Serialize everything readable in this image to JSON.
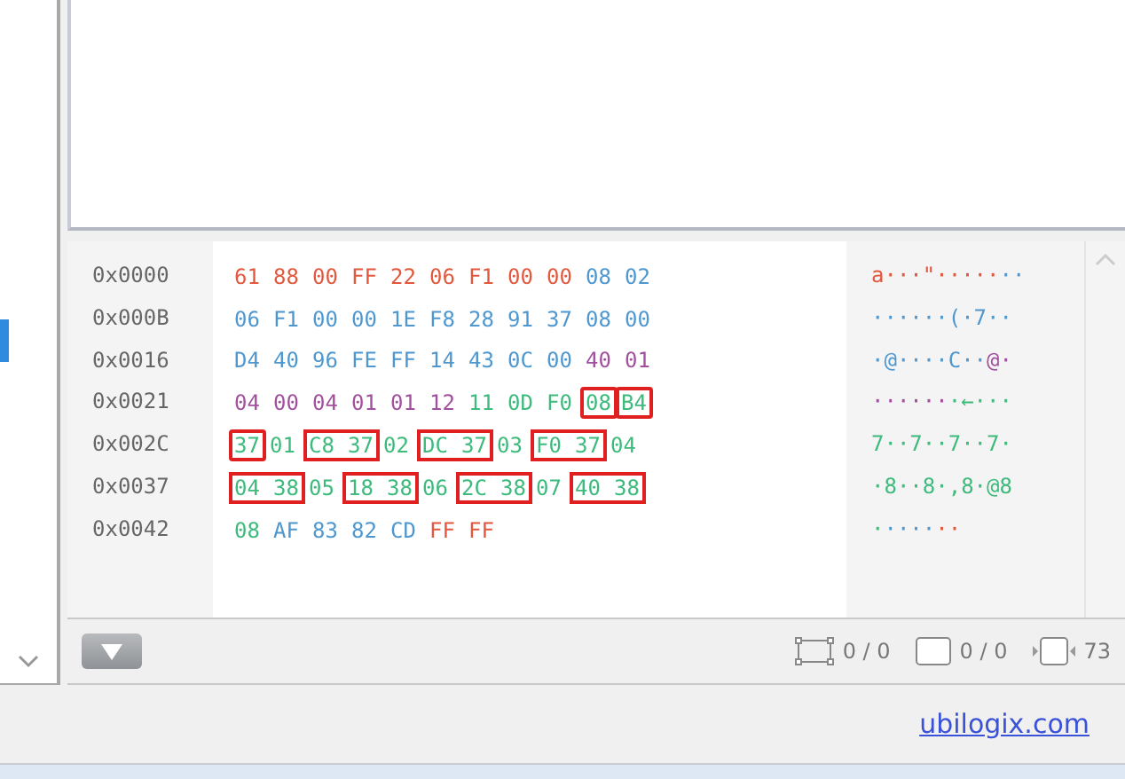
{
  "hex_view": {
    "rows": [
      {
        "offset": "0x0000",
        "cells": [
          {
            "kind": "byte",
            "text": "61",
            "color": "#e2583e"
          },
          {
            "kind": "byte",
            "text": "88",
            "color": "#e2583e"
          },
          {
            "kind": "byte",
            "text": "00",
            "color": "#e2583e"
          },
          {
            "kind": "byte",
            "text": "FF",
            "color": "#e2583e"
          },
          {
            "kind": "byte",
            "text": "22",
            "color": "#e2583e"
          },
          {
            "kind": "byte",
            "text": "06",
            "color": "#e2583e"
          },
          {
            "kind": "byte",
            "text": "F1",
            "color": "#e2583e"
          },
          {
            "kind": "byte",
            "text": "00",
            "color": "#e2583e"
          },
          {
            "kind": "byte",
            "text": "00",
            "color": "#e2583e"
          },
          {
            "kind": "byte",
            "text": "08",
            "color": "#4f97cf"
          },
          {
            "kind": "byte",
            "text": "02",
            "color": "#4f97cf"
          }
        ],
        "ascii": [
          {
            "text": "a···\"·····",
            "color": "#e2583e"
          },
          {
            "text": "··",
            "color": "#4f97cf"
          }
        ]
      },
      {
        "offset": "0x000B",
        "cells": [
          {
            "kind": "byte",
            "text": "06",
            "color": "#4f97cf"
          },
          {
            "kind": "byte",
            "text": "F1",
            "color": "#4f97cf"
          },
          {
            "kind": "byte",
            "text": "00",
            "color": "#4f97cf"
          },
          {
            "kind": "byte",
            "text": "00",
            "color": "#4f97cf"
          },
          {
            "kind": "byte",
            "text": "1E",
            "color": "#4f97cf"
          },
          {
            "kind": "byte",
            "text": "F8",
            "color": "#4f97cf"
          },
          {
            "kind": "byte",
            "text": "28",
            "color": "#4f97cf"
          },
          {
            "kind": "byte",
            "text": "91",
            "color": "#4f97cf"
          },
          {
            "kind": "byte",
            "text": "37",
            "color": "#4f97cf"
          },
          {
            "kind": "byte",
            "text": "08",
            "color": "#4f97cf"
          },
          {
            "kind": "byte",
            "text": "00",
            "color": "#4f97cf"
          }
        ],
        "ascii": [
          {
            "text": "······(·7··",
            "color": "#4f97cf"
          }
        ]
      },
      {
        "offset": "0x0016",
        "cells": [
          {
            "kind": "byte",
            "text": "D4",
            "color": "#4f97cf"
          },
          {
            "kind": "byte",
            "text": "40",
            "color": "#4f97cf"
          },
          {
            "kind": "byte",
            "text": "96",
            "color": "#4f97cf"
          },
          {
            "kind": "byte",
            "text": "FE",
            "color": "#4f97cf"
          },
          {
            "kind": "byte",
            "text": "FF",
            "color": "#4f97cf"
          },
          {
            "kind": "byte",
            "text": "14",
            "color": "#4f97cf"
          },
          {
            "kind": "byte",
            "text": "43",
            "color": "#4f97cf"
          },
          {
            "kind": "byte",
            "text": "0C",
            "color": "#4f97cf"
          },
          {
            "kind": "byte",
            "text": "00",
            "color": "#4f97cf"
          },
          {
            "kind": "byte",
            "text": "40",
            "color": "#a2509e"
          },
          {
            "kind": "byte",
            "text": "01",
            "color": "#a2509e"
          }
        ],
        "ascii": [
          {
            "text": "·@····C··",
            "color": "#4f97cf"
          },
          {
            "text": "@·",
            "color": "#a2509e"
          }
        ]
      },
      {
        "offset": "0x0021",
        "cells": [
          {
            "kind": "byte",
            "text": "04",
            "color": "#a2509e"
          },
          {
            "kind": "byte",
            "text": "00",
            "color": "#a2509e"
          },
          {
            "kind": "byte",
            "text": "04",
            "color": "#a2509e"
          },
          {
            "kind": "byte",
            "text": "01",
            "color": "#a2509e"
          },
          {
            "kind": "byte",
            "text": "01",
            "color": "#a2509e"
          },
          {
            "kind": "byte",
            "text": "12",
            "color": "#a2509e"
          },
          {
            "kind": "byte",
            "text": "11",
            "color": "#3dba7c"
          },
          {
            "kind": "byte",
            "text": "0D",
            "color": "#3dba7c"
          },
          {
            "kind": "byte",
            "text": "F0",
            "color": "#3dba7c"
          },
          {
            "kind": "framed",
            "text": "08",
            "color": "#3dba7c"
          },
          {
            "kind": "framed",
            "text": "B4",
            "color": "#3dba7c"
          }
        ],
        "ascii": [
          {
            "text": "······",
            "color": "#a2509e"
          },
          {
            "text": "·←···",
            "color": "#3dba7c"
          }
        ]
      },
      {
        "offset": "0x002C",
        "cells": [
          {
            "kind": "framed",
            "text": "37",
            "color": "#3dba7c"
          },
          {
            "kind": "byte",
            "text": "01",
            "color": "#3dba7c"
          },
          {
            "kind": "frame_start",
            "text": "C8",
            "color": "#3dba7c"
          },
          {
            "kind": "frame_end",
            "text": "37",
            "color": "#3dba7c"
          },
          {
            "kind": "byte",
            "text": "02",
            "color": "#3dba7c"
          },
          {
            "kind": "frame_start",
            "text": "DC",
            "color": "#3dba7c"
          },
          {
            "kind": "frame_end",
            "text": "37",
            "color": "#3dba7c"
          },
          {
            "kind": "byte",
            "text": "03",
            "color": "#3dba7c"
          },
          {
            "kind": "frame_start",
            "text": "F0",
            "color": "#3dba7c"
          },
          {
            "kind": "frame_end",
            "text": "37",
            "color": "#3dba7c"
          },
          {
            "kind": "byte",
            "text": "04",
            "color": "#3dba7c"
          }
        ],
        "ascii": [
          {
            "text": "7··7··7··7·",
            "color": "#3dba7c"
          }
        ]
      },
      {
        "offset": "0x0037",
        "cells": [
          {
            "kind": "frame_start",
            "text": "04",
            "color": "#3dba7c"
          },
          {
            "kind": "frame_end",
            "text": "38",
            "color": "#3dba7c"
          },
          {
            "kind": "byte",
            "text": "05",
            "color": "#3dba7c"
          },
          {
            "kind": "frame_start",
            "text": "18",
            "color": "#3dba7c"
          },
          {
            "kind": "frame_end",
            "text": "38",
            "color": "#3dba7c"
          },
          {
            "kind": "byte",
            "text": "06",
            "color": "#3dba7c"
          },
          {
            "kind": "frame_start",
            "text": "2C",
            "color": "#3dba7c"
          },
          {
            "kind": "frame_end",
            "text": "38",
            "color": "#3dba7c"
          },
          {
            "kind": "byte",
            "text": "07",
            "color": "#3dba7c"
          },
          {
            "kind": "frame_start",
            "text": "40",
            "color": "#3dba7c"
          },
          {
            "kind": "frame_end",
            "text": "38",
            "color": "#3dba7c"
          }
        ],
        "ascii": [
          {
            "text": "·8··8·,8·@8",
            "color": "#3dba7c"
          }
        ]
      },
      {
        "offset": "0x0042",
        "cells": [
          {
            "kind": "byte",
            "text": "08",
            "color": "#3dba7c"
          },
          {
            "kind": "byte",
            "text": "AF",
            "color": "#4f97cf"
          },
          {
            "kind": "byte",
            "text": "83",
            "color": "#4f97cf"
          },
          {
            "kind": "byte",
            "text": "82",
            "color": "#4f97cf"
          },
          {
            "kind": "byte",
            "text": "CD",
            "color": "#4f97cf"
          },
          {
            "kind": "byte",
            "text": "FF",
            "color": "#e2583e"
          },
          {
            "kind": "byte",
            "text": "FF",
            "color": "#e2583e"
          }
        ],
        "ascii": [
          {
            "text": "·",
            "color": "#3dba7c"
          },
          {
            "text": "····",
            "color": "#4f97cf"
          },
          {
            "text": "··",
            "color": "#e2583e"
          }
        ]
      }
    ]
  },
  "toolbar": {
    "counters": [
      {
        "kind": "selection",
        "text": "0 / 0"
      },
      {
        "kind": "frame",
        "text": "0 / 0"
      },
      {
        "kind": "width",
        "text": "73"
      }
    ]
  },
  "footer": {
    "link": "ubilogix.com"
  }
}
